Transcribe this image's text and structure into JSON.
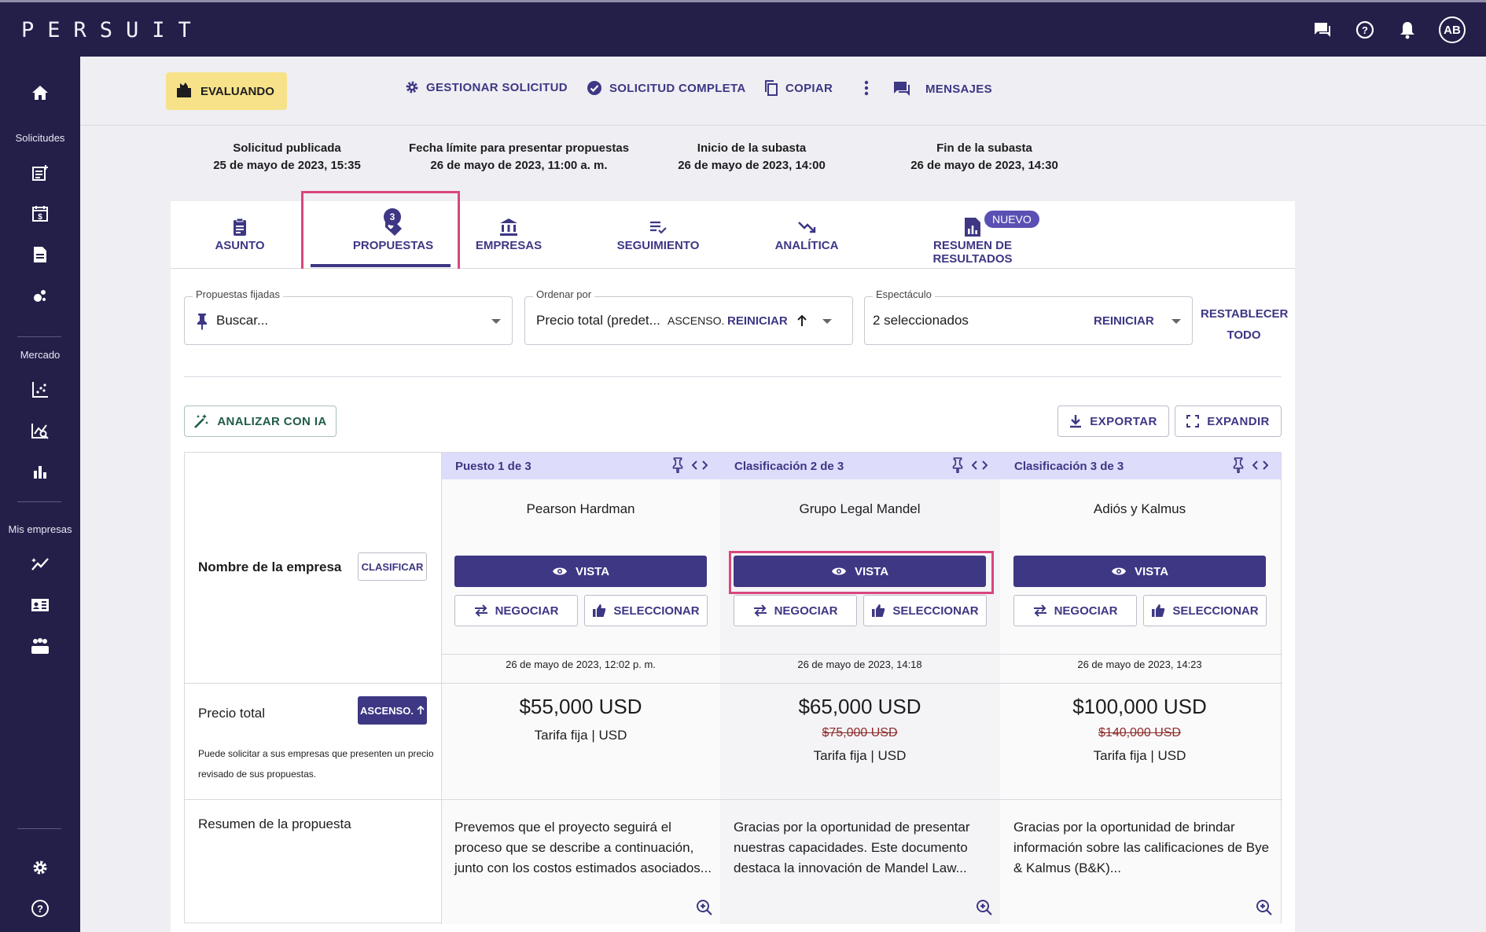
{
  "app": {
    "logo": "PERSUIT",
    "user_initials": "AB"
  },
  "topbar": {
    "icons": [
      "chat-icon",
      "help-icon",
      "bell-icon"
    ]
  },
  "sidebar": {
    "sections": [
      "Solicitudes",
      "Mercado",
      "Mis empresas"
    ]
  },
  "header": {
    "status": "EVALUANDO",
    "actions": {
      "manage": "GESTIONAR SOLICITUD",
      "complete": "SOLICITUD COMPLETA",
      "copy": "COPIAR",
      "messages": "MENSAJES"
    }
  },
  "dates": [
    {
      "label": "Solicitud publicada",
      "value": "25 de mayo de 2023, 15:35"
    },
    {
      "label": "Fecha límite para presentar propuestas",
      "value": "26 de mayo de 2023, 11:00 a. m."
    },
    {
      "label": "Inicio de la subasta",
      "value": "26 de mayo de 2023, 14:00"
    },
    {
      "label": "Fin de la subasta",
      "value": "26 de mayo de 2023, 14:30"
    }
  ],
  "tabs": {
    "asunto": "ASUNTO",
    "propuestas": "PROPUESTAS",
    "propuestas_count": "3",
    "empresas": "EMPRESAS",
    "seguimiento": "SEGUIMIENTO",
    "analitica": "ANALÍTICA",
    "resumen": "RESUMEN DE RESULTADOS",
    "nuevo_badge": "NUEVO"
  },
  "filters": {
    "pinned": {
      "label": "Propuestas fijadas",
      "placeholder": "Buscar..."
    },
    "sort": {
      "label": "Ordenar por",
      "value": "Precio total (predet...",
      "direction": "ASCENSO.",
      "reset": "REINICIAR"
    },
    "show": {
      "label": "Espectáculo",
      "value": "2 seleccionados",
      "reset": "REINICIAR"
    },
    "reset_all_1": "RESTABLECER",
    "reset_all_2": "TODO"
  },
  "toolbar": {
    "ai": "ANALIZAR CON IA",
    "export": "EXPORTAR",
    "expand": "EXPANDIR"
  },
  "rows": {
    "firm_name": "Nombre de la empresa",
    "rank_button": "CLASIFICAR",
    "total_price": "Precio total",
    "asc_button": "ASCENSO.",
    "price_note": "Puede solicitar a sus empresas que presenten un precio revisado de sus propuestas.",
    "summary": "Resumen de la propuesta"
  },
  "buttons": {
    "view": "VISTA",
    "negotiate": "NEGOCIAR",
    "select": "SELECCIONAR"
  },
  "proposals": [
    {
      "header": "Puesto 1 de 3",
      "firm": "Pearson Hardman",
      "submitted": "26 de mayo de 2023, 12:02 p. m.",
      "price": "$55,000 USD",
      "original_price": "",
      "fee": "Tarifa fija | USD",
      "summary": "Prevemos que el proyecto seguirá el proceso que se describe a continuación, junto con los costos estimados asociados..."
    },
    {
      "header": "Clasificación 2 de 3",
      "firm": "Grupo Legal Mandel",
      "submitted": "26 de mayo de 2023, 14:18",
      "price": "$65,000 USD",
      "original_price": "$75,000 USD",
      "fee": "Tarifa fija | USD",
      "summary": "Gracias por la oportunidad de presentar nuestras capacidades. Este documento destaca la innovación de Mandel Law..."
    },
    {
      "header": "Clasificación 3 de 3",
      "firm": "Adiós y Kalmus",
      "submitted": "26 de mayo de 2023, 14:23",
      "price": "$100,000 USD",
      "original_price": "$140,000 USD",
      "fee": "Tarifa fija | USD",
      "summary": "Gracias por la oportunidad de brindar información sobre las calificaciones de Bye & Kalmus (B&K)..."
    }
  ],
  "colors": {
    "primary": "#3d3784",
    "nav": "#231f49",
    "status": "#f7e28a",
    "highlight": "#d9457f"
  }
}
